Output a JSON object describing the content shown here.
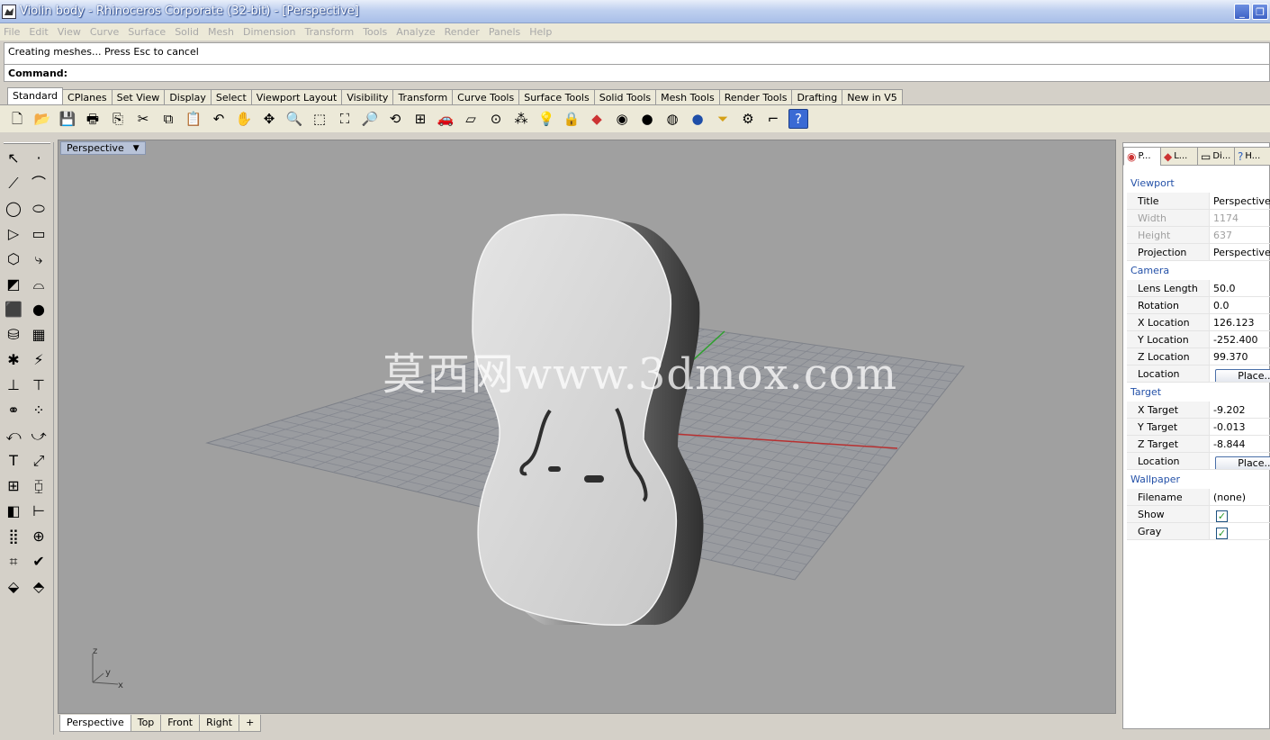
{
  "window": {
    "title": "Violin body - Rhinoceros Corporate (32-bit) - [Perspective]"
  },
  "menu": [
    "File",
    "Edit",
    "View",
    "Curve",
    "Surface",
    "Solid",
    "Mesh",
    "Dimension",
    "Transform",
    "Tools",
    "Analyze",
    "Render",
    "Panels",
    "Help"
  ],
  "command": {
    "history": "Creating meshes... Press Esc to cancel",
    "prompt": "Command:"
  },
  "toolbar_tabs": [
    "Standard",
    "CPlanes",
    "Set View",
    "Display",
    "Select",
    "Viewport Layout",
    "Visibility",
    "Transform",
    "Curve Tools",
    "Surface Tools",
    "Solid Tools",
    "Mesh Tools",
    "Render Tools",
    "Drafting",
    "New in V5"
  ],
  "viewport": {
    "title": "Perspective",
    "watermark": "莫西网www.3dmox.com",
    "axis_z": "z",
    "axis_y": "y",
    "axis_x": "x"
  },
  "viewport_tabs": [
    "Perspective",
    "Top",
    "Front",
    "Right",
    "+"
  ],
  "panel": {
    "tabs": [
      "P...",
      "L...",
      "Di...",
      "H..."
    ],
    "sections": {
      "viewport": "Viewport",
      "camera": "Camera",
      "target": "Target",
      "wallpaper": "Wallpaper"
    },
    "viewport_rows": [
      {
        "k": "Title",
        "v": "Perspective"
      },
      {
        "k": "Width",
        "v": "1174"
      },
      {
        "k": "Height",
        "v": "637"
      },
      {
        "k": "Projection",
        "v": "Perspective"
      }
    ],
    "camera_rows": [
      {
        "k": "Lens Length",
        "v": "50.0"
      },
      {
        "k": "Rotation",
        "v": "0.0"
      },
      {
        "k": "X Location",
        "v": "126.123"
      },
      {
        "k": "Y Location",
        "v": "-252.400"
      },
      {
        "k": "Z Location",
        "v": "99.370"
      },
      {
        "k": "Location",
        "v": "Place..."
      }
    ],
    "target_rows": [
      {
        "k": "X Target",
        "v": "-9.202"
      },
      {
        "k": "Y Target",
        "v": "-0.013"
      },
      {
        "k": "Z Target",
        "v": "-8.844"
      },
      {
        "k": "Location",
        "v": "Place..."
      }
    ],
    "wallpaper_rows": [
      {
        "k": "Filename",
        "v": "(none)"
      },
      {
        "k": "Show",
        "v": "✓"
      },
      {
        "k": "Gray",
        "v": "✓"
      }
    ]
  },
  "colors": {
    "viewport_bg": "#a0a0a0",
    "titlebar": "#a9bfe8",
    "section_text": "#2451a8"
  }
}
